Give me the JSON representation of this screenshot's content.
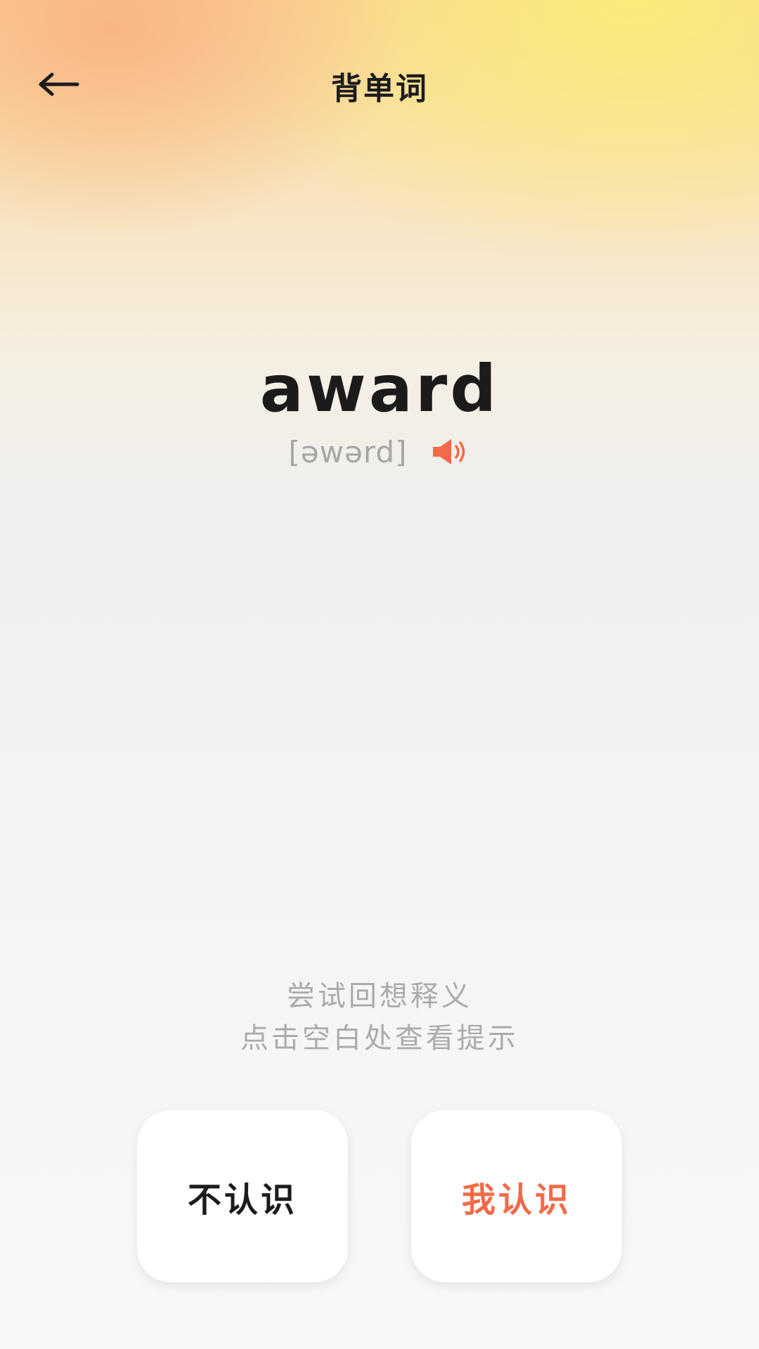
{
  "header": {
    "title": "背单词",
    "back_icon": "arrow-left-icon"
  },
  "card": {
    "word": "award",
    "phonetic": "[əwərd]",
    "speaker_icon": "speaker-icon"
  },
  "hint": {
    "line1": "尝试回想释义",
    "line2": "点击空白处查看提示"
  },
  "actions": {
    "unknown_label": "不认识",
    "known_label": "我认识"
  },
  "colors": {
    "accent": "#f26a48",
    "text_dark": "#1c1c1c",
    "text_muted": "#a6a6a6"
  }
}
